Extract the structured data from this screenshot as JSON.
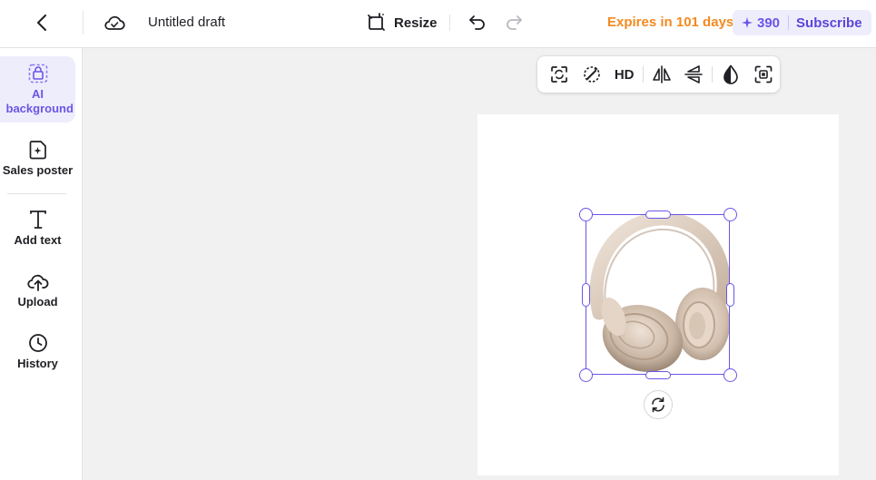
{
  "header": {
    "draft_title": "Untitled draft",
    "resize_label": "Resize",
    "expires_text": "Expires in 101 days",
    "credits": "390",
    "subscribe_label": "Subscribe",
    "icons": [
      "chevron-left-icon",
      "cloud-icon",
      "resize-icon",
      "undo-icon",
      "redo-icon",
      "sparkle-icon"
    ]
  },
  "sidebar": {
    "items": [
      {
        "label": "AI background",
        "icon": "ai-background-icon",
        "active": true
      },
      {
        "label": "Sales poster",
        "icon": "sales-poster-icon",
        "active": false
      },
      {
        "label": "Add text",
        "icon": "text-icon",
        "active": false
      },
      {
        "label": "Upload",
        "icon": "upload-cloud-icon",
        "active": false
      },
      {
        "label": "History",
        "icon": "clock-icon",
        "active": false
      }
    ]
  },
  "floating_toolbar": {
    "hd_label": "HD",
    "icons": [
      "replace-icon",
      "magic-eraser-icon",
      "hd-icon",
      "flip-horizontal-icon",
      "flip-vertical-icon",
      "opacity-icon",
      "crop-focus-icon"
    ]
  },
  "canvas": {
    "selected_object": "headphones-image",
    "rotate_icon": "rotate-icon"
  },
  "colors": {
    "accent": "#6b55e6",
    "expires": "#f5891f",
    "active_bg": "#eeedfc"
  }
}
